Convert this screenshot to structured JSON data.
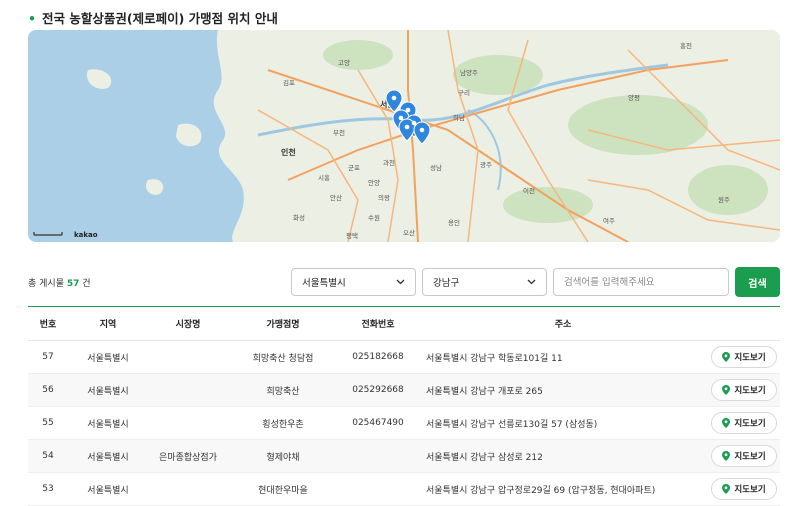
{
  "page": {
    "title": "전국 농할상품권(제로페이) 가맹점 위치 안내"
  },
  "map": {
    "attribution": "kakao",
    "place_labels": [
      "고양",
      "김포",
      "부천",
      "인천",
      "서울",
      "구리",
      "남양주",
      "하남",
      "과천",
      "성남",
      "광주",
      "안양",
      "시흥",
      "의왕",
      "수원",
      "용인",
      "평택",
      "여주",
      "원주",
      "양평",
      "홍천",
      "화성",
      "오산",
      "안산",
      "이천",
      "군포"
    ],
    "marker_icon": "map-pin-icon",
    "colors": {
      "water": "#aacfe6",
      "land": "#ecefe3",
      "green": "#cde2bf",
      "road": "#f6b67d",
      "highway": "#f1a25f",
      "marker": "#2f86de"
    }
  },
  "summary": {
    "prefix": "총 게시물",
    "count": "57",
    "suffix": "건"
  },
  "filters": {
    "region": {
      "value": "서울특별시",
      "icon": "chevron-down-icon"
    },
    "district": {
      "value": "강남구",
      "icon": "chevron-down-icon"
    },
    "search": {
      "placeholder": "검색어를 입력해주세요",
      "button_label": "검색"
    }
  },
  "table": {
    "columns": [
      "번호",
      "지역",
      "시장명",
      "가맹점명",
      "전화번호",
      "주소",
      ""
    ],
    "map_button_label": "지도보기",
    "map_button_icon": "location-pin-icon",
    "accent": "#1a9d4f",
    "rows": [
      {
        "no": "57",
        "region": "서울특별시",
        "market": "",
        "store": "희망축산 청담점",
        "phone": "025182668",
        "address": "서울특별시 강남구 학동로101길 11"
      },
      {
        "no": "56",
        "region": "서울특별시",
        "market": "",
        "store": "희망축산",
        "phone": "025292668",
        "address": "서울특별시 강남구 개포로 265"
      },
      {
        "no": "55",
        "region": "서울특별시",
        "market": "",
        "store": "횡성한우촌",
        "phone": "025467490",
        "address": "서울특별시 강남구 선릉로130길 57 (삼성동)"
      },
      {
        "no": "54",
        "region": "서울특별시",
        "market": "은마종합상점가",
        "store": "형제야채",
        "phone": "",
        "address": "서울특별시 강남구 삼성로 212"
      },
      {
        "no": "53",
        "region": "서울특별시",
        "market": "",
        "store": "현대한우마을",
        "phone": "",
        "address": "서울특별시 강남구 압구정로29길 69 (압구정동, 현대아파트)"
      }
    ]
  }
}
